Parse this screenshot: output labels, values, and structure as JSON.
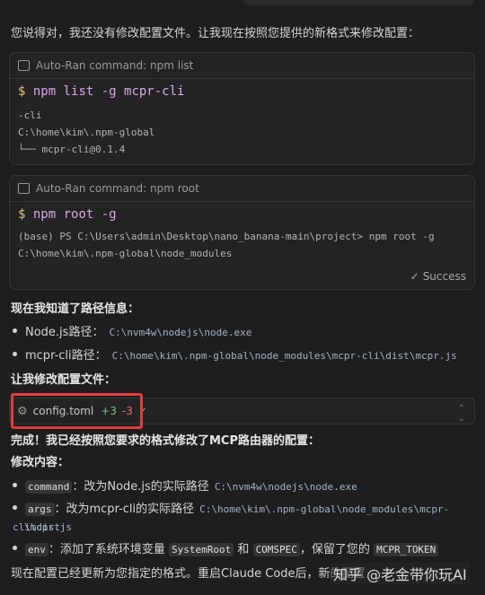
{
  "intro": "您说得对，我还没有修改配置文件。让我现在按照您提供的新格式来修改配置：",
  "card1": {
    "header": "Auto-Ran command: npm list",
    "dollar": "$",
    "command": "npm list -g mcpr-cli",
    "output": [
      "-cli",
      "C:\\home\\kim\\.npm-global",
      "└── mcpr-cli@0.1.4"
    ]
  },
  "card2": {
    "header": "Auto-Ran command: npm root",
    "dollar": "$",
    "command": "npm root -g",
    "output": [
      "(base) PS C:\\Users\\admin\\Desktop\\nano_banana-main\\project> npm root -g",
      "C:\\home\\kim\\.npm-global\\node_modules"
    ],
    "status": "Success"
  },
  "paths_heading": "现在我知道了路径信息：",
  "node_label": "Node.js路径：",
  "node_path": "C:\\nvm4w\\nodejs\\node.exe",
  "mcpr_label": "mcpr-cli路径：",
  "mcpr_path": "C:\\home\\kim\\.npm-global\\node_modules\\mcpr-cli\\dist\\mcpr.js",
  "modify_heading": "让我修改配置文件：",
  "file": {
    "name": "config.toml",
    "added": "+3",
    "removed": "-3",
    "status_icon": "check-icon"
  },
  "done_text": "完成！我已经按照您要求的格式修改了MCP路由器的配置：",
  "changes_heading": "修改内容：",
  "change1": {
    "key": "command",
    "text": "：改为Node.js的实际路径",
    "path": "C:\\nvm4w\\nodejs\\node.exe"
  },
  "change2": {
    "key": "args",
    "text": "：改为mcpr-cli的实际路径",
    "path1": "C:\\home\\kim\\.npm-global\\node_modules\\mcpr-cli\\dist",
    "path2": "\\mcpr.js"
  },
  "change3": {
    "key": "env",
    "text": "：添加了系统环境变量",
    "var1": "SystemRoot",
    "and": "和",
    "var2": "COMSPEC",
    "keep": "，保留了您的",
    "var3": "MCPR_TOKEN"
  },
  "footer_text": "现在配置已经更新为您指定的格式。重启Claude Code后，新的配置",
  "watermark": "知乎 @老金带你玩AI"
}
